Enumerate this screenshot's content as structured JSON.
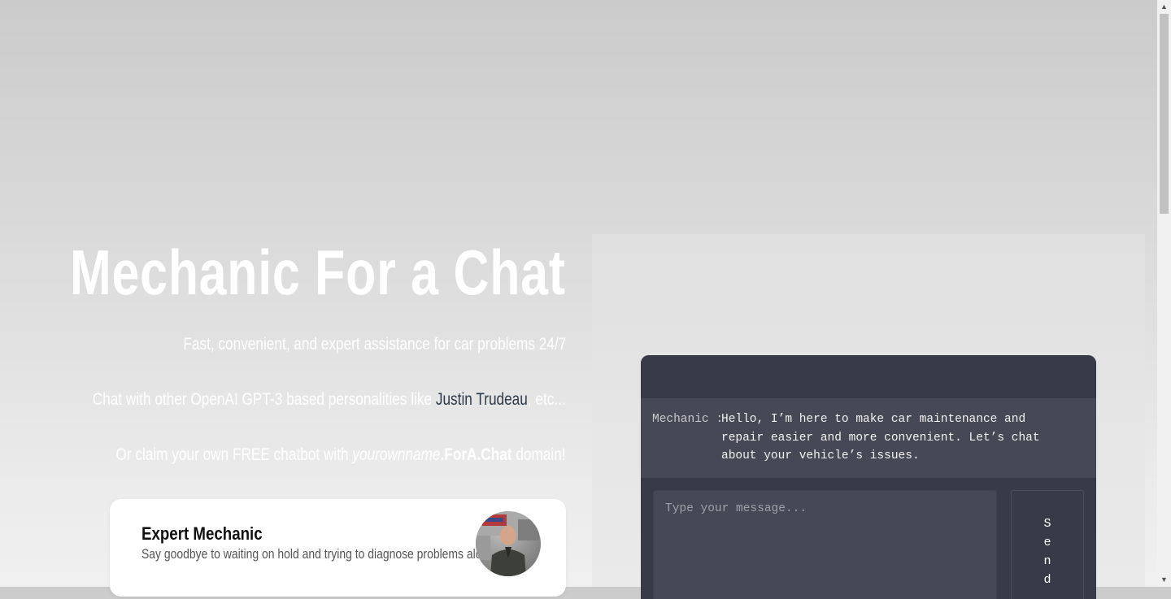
{
  "hero": {
    "title": "Mechanic For a Chat",
    "tagline": "Fast, convenient, and expert assistance for car problems 24/7",
    "others_prefix": "Chat with other OpenAI GPT-3 based personalities like ",
    "others_link": "Justin Trudeau",
    "others_suffix": ", etc...",
    "claim_prefix": "Or claim your own FREE chatbot with ",
    "claim_name": "yourownname",
    "claim_domain": ".ForA.Chat",
    "claim_suffix": " domain!"
  },
  "card": {
    "title": "Expert Mechanic",
    "subtitle": "Say goodbye to waiting on hold and trying to diagnose problems alone"
  },
  "chat": {
    "sender": "Mechanic :",
    "message": "Hello, I’m here to make car maintenance and repair easier and more convenient. Let’s chat about your vehicle’s issues.",
    "input_placeholder": "Type your message...",
    "send_label": "Send"
  },
  "colors": {
    "chat_bg": "#393a47",
    "message_bg": "#474856",
    "link": "#2e3a48"
  }
}
